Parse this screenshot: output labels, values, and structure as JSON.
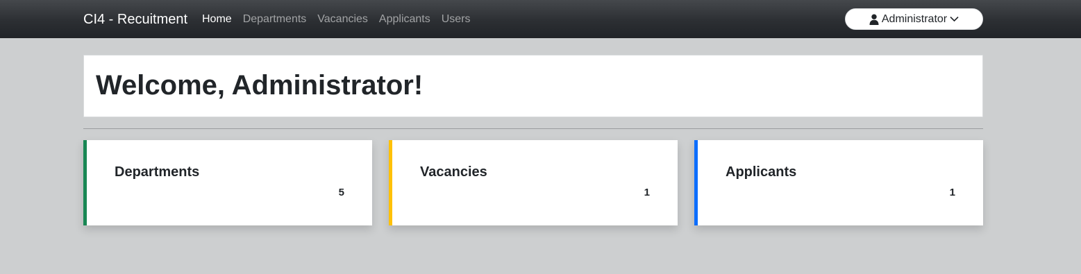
{
  "navbar": {
    "brand": "CI4 - Recuitment",
    "links": [
      {
        "label": "Home",
        "active": true
      },
      {
        "label": "Departments",
        "active": false
      },
      {
        "label": "Vacancies",
        "active": false
      },
      {
        "label": "Applicants",
        "active": false
      },
      {
        "label": "Users",
        "active": false
      }
    ],
    "user_menu": {
      "label": "Administrator",
      "icon": "user-icon",
      "caret_icon": "chevron-down-icon"
    }
  },
  "welcome": {
    "title": "Welcome, Administrator!"
  },
  "stats": [
    {
      "label": "Departments",
      "value": "5",
      "accent": "#198754"
    },
    {
      "label": "Vacancies",
      "value": "1",
      "accent": "#ffc107"
    },
    {
      "label": "Applicants",
      "value": "1",
      "accent": "#0d6efd"
    }
  ]
}
